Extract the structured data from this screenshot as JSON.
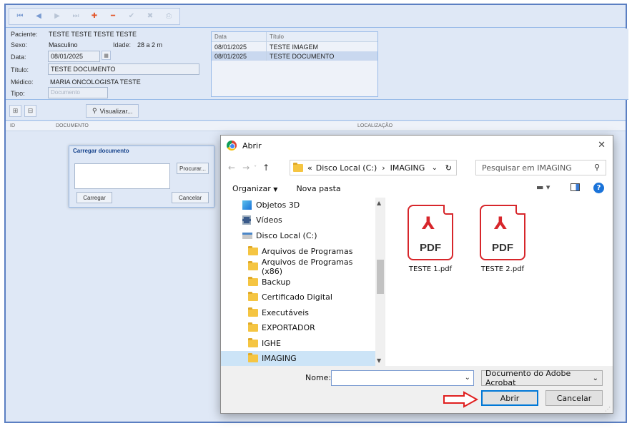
{
  "form": {
    "paciente_label": "Paciente:",
    "paciente": "TESTE TESTE TESTE TESTE",
    "sexo_label": "Sexo:",
    "sexo": "Masculino",
    "idade_label": "Idade:",
    "idade": "28 a 2 m",
    "data_label": "Data:",
    "data": "08/01/2025",
    "titulo_label": "Título:",
    "titulo": "TESTE DOCUMENTO",
    "medico_label": "Médico:",
    "medico": "MARIA ONCOLOGISTA TESTE",
    "tipo_label": "Tipo:",
    "tipo": "Documento"
  },
  "docs_grid": {
    "headers": [
      "Data",
      "Título"
    ],
    "rows": [
      {
        "data": "08/01/2025",
        "titulo": "TESTE IMAGEM"
      },
      {
        "data": "08/01/2025",
        "titulo": "TESTE DOCUMENTO"
      }
    ]
  },
  "toolbar2": {
    "visualizar": "Visualizar..."
  },
  "main_grid": {
    "headers": [
      "ID",
      "DOCUMENTO",
      "LOCALIZAÇÃO"
    ]
  },
  "carregar": {
    "title": "Carregar documento",
    "procurar": "Procurar...",
    "carregar": "Carregar",
    "cancelar": "Cancelar"
  },
  "dialog": {
    "title": "Abrir",
    "path_prefix": "«",
    "path_drive": "Disco Local (C:)",
    "path_sep": "›",
    "path_folder": "IMAGING",
    "search_placeholder": "Pesquisar em IMAGING",
    "organizar": "Organizar",
    "nova_pasta": "Nova pasta",
    "tree": [
      {
        "label": "Objetos 3D",
        "icon": "cube-icon"
      },
      {
        "label": "Vídeos",
        "icon": "video-icon"
      },
      {
        "label": "Disco Local (C:)",
        "icon": "drive-icon"
      },
      {
        "label": "Arquivos de Programas",
        "icon": "folder-icon"
      },
      {
        "label": "Arquivos de Programas (x86)",
        "icon": "folder-icon"
      },
      {
        "label": "Backup",
        "icon": "folder-icon"
      },
      {
        "label": "Certificado Digital",
        "icon": "folder-icon"
      },
      {
        "label": "Executáveis",
        "icon": "folder-icon"
      },
      {
        "label": "EXPORTADOR",
        "icon": "folder-icon"
      },
      {
        "label": "IGHE",
        "icon": "folder-icon"
      },
      {
        "label": "IMAGING",
        "icon": "folder-icon"
      }
    ],
    "files": [
      {
        "name": "TESTE 1.pdf",
        "type": "PDF"
      },
      {
        "name": "TESTE 2.pdf",
        "type": "PDF"
      }
    ],
    "nome_label": "Nome:",
    "nome_value": "",
    "file_type": "Documento do Adobe Acrobat",
    "abrir": "Abrir",
    "cancelar": "Cancelar"
  },
  "colors": {
    "accent": "#0078d7",
    "pdf_red": "#d7262b",
    "app_bg": "#dfe8f6",
    "arrow_red": "#e02020"
  }
}
